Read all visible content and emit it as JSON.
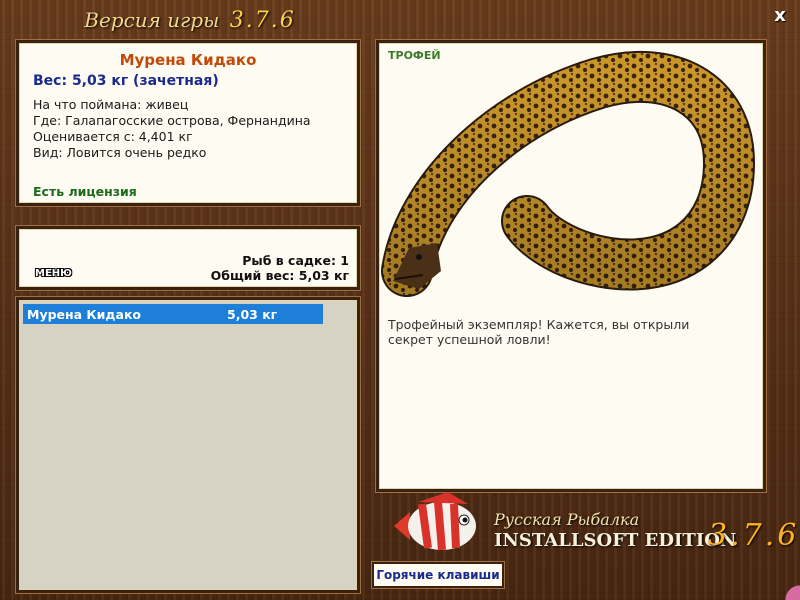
{
  "header": {
    "title": "Версия игры",
    "version": "3.7.6",
    "close_label": "x"
  },
  "fish": {
    "name": "Мурена Кидако",
    "weight": "Вес: 5,03 кг (зачетная)",
    "bait": "На что поймана: живец",
    "location": "Где: Галапагосские острова, Фернандина",
    "rated_from": "Оценивается с: 4,401 кг",
    "rarity": "Вид: Ловится очень редко",
    "license": "Есть лицензия"
  },
  "stats": {
    "menu_label": "МЕНЮ",
    "fish_count": "Рыб в садке: 1",
    "total_weight": "Общий вес: 5,03 кг"
  },
  "catch_list": [
    {
      "name": "Мурена Кидако",
      "weight": "5,03 кг",
      "selected": true
    }
  ],
  "trophy": {
    "tag": "ТРОФЕЙ",
    "description": "Трофейный экземпляр! Кажется, вы открыли секрет успешной ловли!"
  },
  "logo": {
    "line1": "Русская Рыбалка",
    "line2": "INSTALLSOFT EDITION",
    "version": "3.7.6"
  },
  "footer": {
    "hotkeys_label": "Горячие клавиши"
  }
}
